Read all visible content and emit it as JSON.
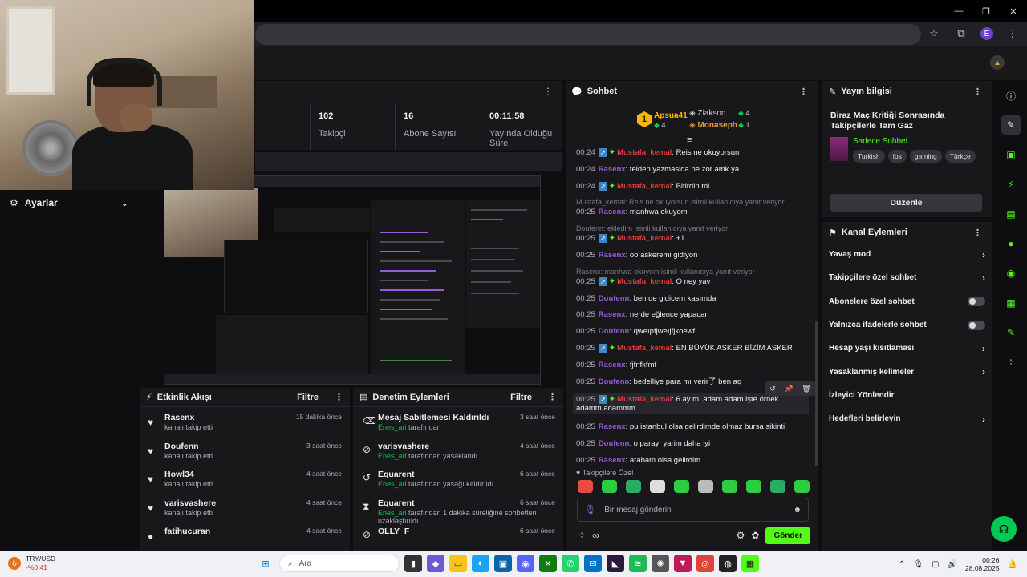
{
  "stats": [
    {
      "value": "102",
      "label": "Takipçi"
    },
    {
      "value": "16",
      "label": "Abone Sayısı"
    },
    {
      "value": "00:11:58",
      "label": "Yayında Olduğu Süre"
    }
  ],
  "left": {
    "settings_label": "Ayarlar"
  },
  "feed": {
    "title": "Etkinlik Akışı",
    "filter": "Filtre",
    "items": [
      {
        "name": "Rasenx",
        "desc": "kanalı takip etti",
        "time": "15 dakika önce"
      },
      {
        "name": "Doufenn",
        "desc": "kanalı takip etti",
        "time": "3 saat önce"
      },
      {
        "name": "Howl34",
        "desc": "kanalı takip etti",
        "time": "4 saat önce"
      },
      {
        "name": "varisvashere",
        "desc": "kanalı takip etti",
        "time": "4 saat önce"
      },
      {
        "name": "fatihucuran",
        "desc": "",
        "time": "4 saat önce"
      }
    ]
  },
  "mod": {
    "title": "Denetim Eylemleri",
    "filter": "Filtre",
    "items": [
      {
        "name": "Mesaj Sabitlemesi Kaldırıldı",
        "by": "Enes_ari",
        "desc": "tarafından",
        "time": "3 saat önce"
      },
      {
        "name": "varisvashere",
        "by": "Enes_ari",
        "desc": "tarafından yasaklandı",
        "time": "4 saat önce"
      },
      {
        "name": "Equarent",
        "by": "Enes_ari",
        "desc": "tarafından yasağı kaldırıldı",
        "time": "6 saat önce"
      },
      {
        "name": "Equarent",
        "by": "Enes_ari",
        "desc": "tarafından 1 dakika süreliğine sohbetten uzaklaştırıldı",
        "time": "6 saat önce"
      },
      {
        "name": "OLLY_F",
        "by": "",
        "desc": "",
        "time": "6 saat önce"
      }
    ]
  },
  "chat": {
    "title": "Sohbet",
    "leaders": [
      {
        "rank": "1",
        "name": "Apsua41",
        "count": "4"
      },
      {
        "name": "Ziakson",
        "count": "4"
      },
      {
        "name": "Monaseph",
        "count": "1"
      }
    ],
    "messages": [
      {
        "ts": "00:24",
        "user": "Mustafa_kemal",
        "text": ": Reis ne okuyorsun"
      },
      {
        "ts": "00:24",
        "user": "Rasenx",
        "text": ": telden yazmasida ne zor amk ya"
      },
      {
        "ts": "00:24",
        "user": "Mustafa_kemal",
        "text": ": Bitirdin mi"
      },
      {
        "reply": "Mustafa_kemal: Reis ne okuyorsun isimli kullanıcıya yanıt veriyor",
        "ts": "00:25",
        "user": "Rasenx",
        "text": ": manhwa okuyom"
      },
      {
        "reply": "Doufenn: ekledim isimli kullanıcıya yanıt veriyor",
        "ts": "00:25",
        "user": "Mustafa_kemal",
        "text": ": +1"
      },
      {
        "ts": "00:25",
        "user": "Rasenx",
        "text": ": oo askeremi gidiyon"
      },
      {
        "reply": "Rasenx: manhwa okuyom isimli kullanıcıya yanıt veriyor",
        "ts": "00:25",
        "user": "Mustafa_kemal",
        "text": ": O ney yav"
      },
      {
        "ts": "00:25",
        "user": "Doufenn",
        "text": ": ben de gidicem kasımda"
      },
      {
        "ts": "00:25",
        "user": "Rasenx",
        "text": ": nerde eğlence yapacan"
      },
      {
        "ts": "00:25",
        "user": "Doufenn",
        "text": ": qweıpfjweıjfjkoewf"
      },
      {
        "ts": "00:25",
        "user": "Mustafa_kemal",
        "text": ": EN BÜYÜK ASKER BİZİM ASKER"
      },
      {
        "ts": "00:25",
        "user": "Rasenx",
        "text": ": fjfnfkfmf"
      },
      {
        "ts": "00:25",
        "user": "Doufenn",
        "text": ": bedelliye para mı verir了 ben aq"
      },
      {
        "ts": "00:25",
        "user": "Mustafa_kemal",
        "text": ": 6 ay mı adam adam işte örnek adamm adammm"
      },
      {
        "ts": "00:25",
        "user": "Rasenx",
        "text": ": pu istanbul olsa gelirdimde olmaz bursa sikinti"
      },
      {
        "ts": "00:25",
        "user": "Doufenn",
        "text": ": o parayı yarim daha iyi"
      },
      {
        "ts": "00:25",
        "user": "Rasenx",
        "text": ": arabam olsa gelirdim"
      }
    ],
    "followers_only": "Takipçilere Özel",
    "input_placeholder": "Bir mesaj gönderin",
    "send_label": "Gönder"
  },
  "info": {
    "title": "Yayın bilgisi",
    "stream_title": "Biraz Maç Kritiği Sonrasında Takipçilerle Tam Gaz",
    "category": "Sadece Sohbet",
    "tags": [
      "Turkish",
      "fps",
      "gaming",
      "Türkçe"
    ],
    "edit_label": "Düzenle"
  },
  "actions": {
    "title": "Kanal Eylemleri",
    "rows": [
      {
        "label": "Yavaş mod",
        "kind": "chevron"
      },
      {
        "label": "Takipçilere özel sohbet",
        "kind": "chevron"
      },
      {
        "label": "Abonelere özel sohbet",
        "kind": "toggle"
      },
      {
        "label": "Yalnızca ifadelerle sohbet",
        "kind": "toggle"
      },
      {
        "label": "Hesap yaşı kısıtlaması",
        "kind": "chevron"
      },
      {
        "label": "Yasaklanmış kelimeler",
        "kind": "chevron"
      },
      {
        "label": "İzleyici Yönlendir",
        "kind": "none"
      },
      {
        "label": "Hedefleri belirleyin",
        "kind": "chevron"
      }
    ]
  },
  "taskbar": {
    "ticker_name": "TRY/USD",
    "ticker_change": "-%0,41",
    "search_placeholder": "Ara",
    "time": "00:26",
    "date": "28.08.2025"
  },
  "colors": {
    "accent": "#53fc18",
    "purple_user": "#9b5ad6",
    "red_user": "#e33b3b"
  }
}
